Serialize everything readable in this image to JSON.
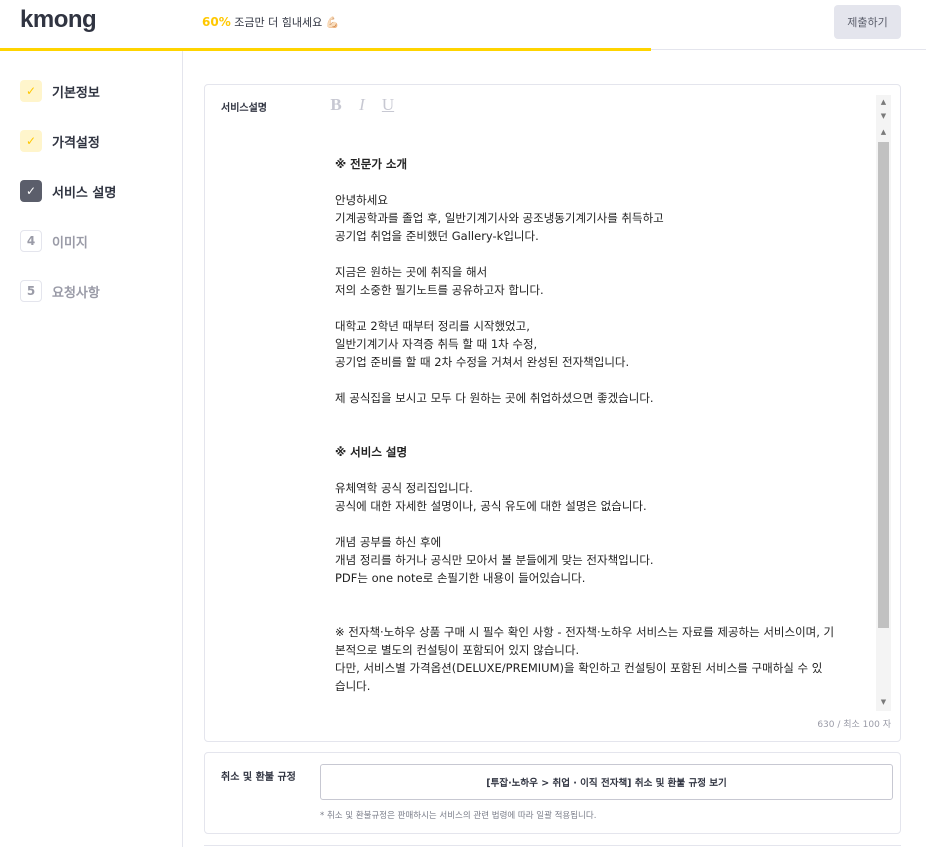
{
  "header": {
    "logo": "kmong",
    "progress_percent": 60,
    "progress_pct_text": "60%",
    "progress_message": "조금만 더 힘내세요",
    "progress_emoji": "💪🏻",
    "submit_label": "제출하기",
    "accent_color": "#ffd400"
  },
  "sidebar": {
    "steps": [
      {
        "marker": "✓",
        "label": "기본정보",
        "state": "done"
      },
      {
        "marker": "✓",
        "label": "가격설정",
        "state": "done"
      },
      {
        "marker": "✓",
        "label": "서비스 설명",
        "state": "current"
      },
      {
        "marker": "4",
        "label": "이미지",
        "state": "todo"
      },
      {
        "marker": "5",
        "label": "요청사항",
        "state": "todo"
      }
    ]
  },
  "description": {
    "label": "서비스설명",
    "toolbar": {
      "bold": "B",
      "italic": "I",
      "underline": "U"
    },
    "lines": [
      "※ 전문가 소개",
      "",
      "안녕하세요",
      "기계공학과를 졸업 후, 일반기계기사와 공조냉동기계기사를 취득하고",
      "공기업 취업을 준비했던 Gallery-k입니다.",
      "",
      "지금은 원하는 곳에 취직을 해서",
      "저의 소중한 필기노트를 공유하고자 합니다.",
      "",
      "대학교 2학년 때부터 정리를 시작했었고,",
      "일반기계기사 자격증 취득 할 때 1차 수정,",
      "공기업 준비를 할 때 2차 수정을 거쳐서 완성된 전자책입니다.",
      "",
      "제 공식집을 보시고 모두 다 원하는 곳에 취업하셨으면 좋겠습니다.",
      "",
      "",
      "※ 서비스 설명",
      "",
      "유체역학 공식 정리집입니다.",
      "공식에 대한 자세한 설명이나, 공식 유도에 대한 설명은 없습니다.",
      "",
      "개념 공부를 하신 후에",
      "개념 정리를 하거나 공식만 모아서 볼 분들에게 맞는 전자책입니다.",
      "PDF는 one note로 손필기한 내용이 들어있습니다.",
      "",
      "",
      "※ 전자책·노하우 상품 구매 시 필수 확인 사항 - 전자책·노하우 서비스는 자료를 제공하는 서비스이며, 기",
      "본적으로 별도의 컨설팅이 포함되어 있지 않습니다.",
      "다만, 서비스별 가격옵션(DELUXE/PREMIUM)을 확인하고 컨설팅이 포함된 서비스를 구매하실 수 있",
      "습니다."
    ],
    "char_count": "630 / 최소 100 자"
  },
  "refund": {
    "label": "취소 및 환불 규정",
    "button_label": "[투잡·노하우 > 취업 · 이직 전자책] 취소 및 환불 규정 보기",
    "note": "* 취소 및 환불규정은 판매하시는 서비스의 관련 법령에 따라 일괄 적용됩니다."
  }
}
